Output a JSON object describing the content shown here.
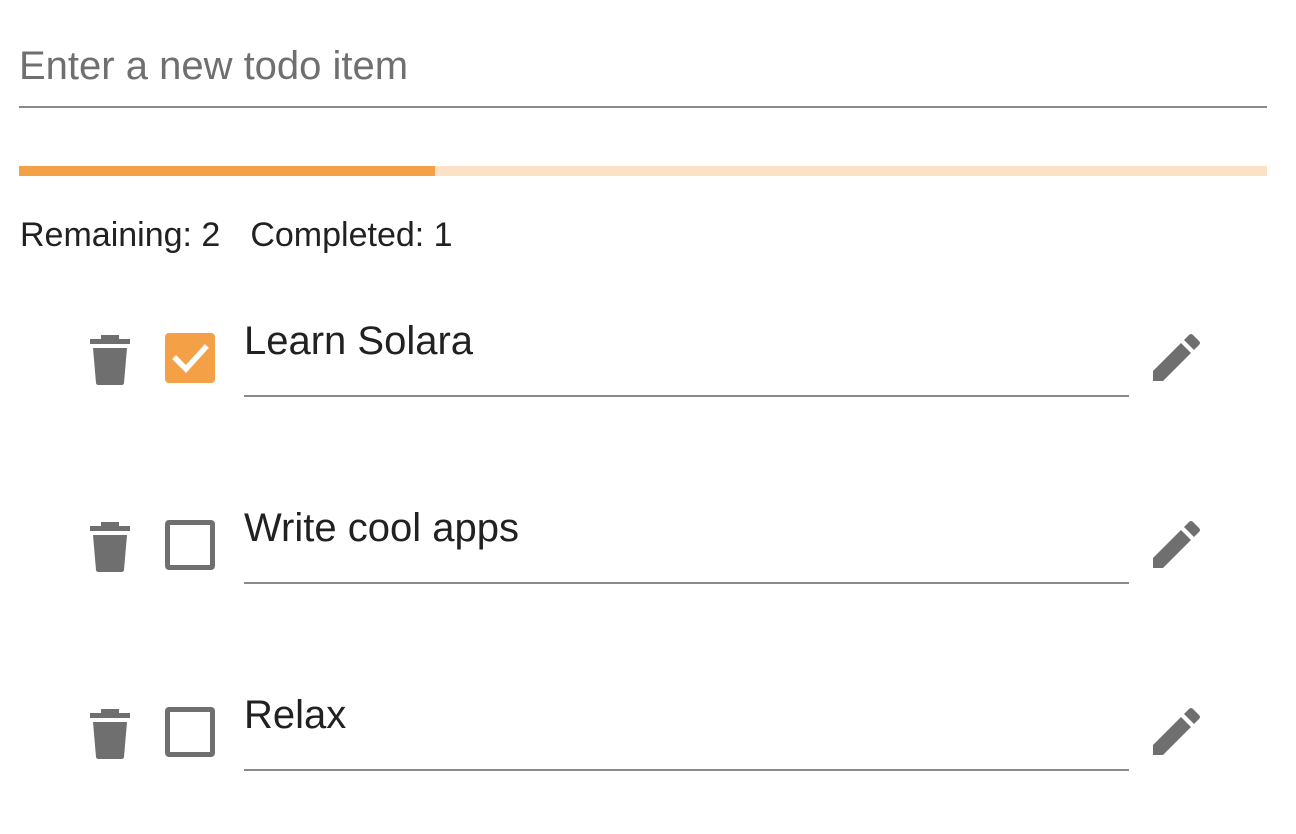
{
  "new_todo": {
    "placeholder": "Enter a new todo item",
    "value": ""
  },
  "progress": {
    "completed_fraction": 0.3333,
    "fill_color": "#f3a046",
    "track_color": "#fbe2c6"
  },
  "counts": {
    "remaining_label": "Remaining: 2",
    "completed_label": "Completed: 1"
  },
  "accent_color": "#f3a046",
  "icons": {
    "delete": "trash-icon",
    "edit": "pencil-icon",
    "check": "check-icon"
  },
  "todos": [
    {
      "text": "Learn Solara",
      "done": true
    },
    {
      "text": "Write cool apps",
      "done": false
    },
    {
      "text": "Relax",
      "done": false
    }
  ]
}
